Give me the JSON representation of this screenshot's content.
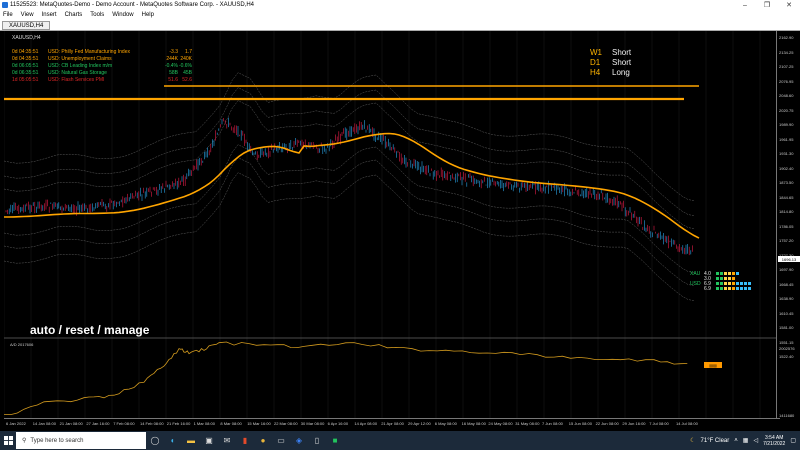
{
  "window": {
    "title": "11525523: MetaQuotes-Demo - Demo Account - MetaQuotes Software Corp. - XAUUSD,H4",
    "min": "–",
    "max": "❐",
    "close": "✕"
  },
  "menu": [
    "File",
    "View",
    "Insert",
    "Charts",
    "Tools",
    "Window",
    "Help"
  ],
  "tab": {
    "label": "XAUUSD,H4"
  },
  "chart": {
    "symbol_label": "XAUUSD,H4",
    "news": [
      {
        "time": "0d 04:35:51",
        "name": "USD: Philly Fed Manufacturing Index",
        "actual": "-3.3",
        "forecast": "1.7",
        "color": "#ffa500"
      },
      {
        "time": "0d 04:35:51",
        "name": "USD: Unemployment Claims",
        "actual": "244K",
        "forecast": "240K",
        "color": "#ffa500"
      },
      {
        "time": "0d 06:05:51",
        "name": "USD: CB Leading Index m/m",
        "actual": "-0.4%",
        "forecast": "-0.6%",
        "color": "#22c55e"
      },
      {
        "time": "0d 06:35:51",
        "name": "USD: Natural Gas Storage",
        "actual": "58B",
        "forecast": "45B",
        "color": "#22c55e"
      },
      {
        "time": "1d 05:05:51",
        "name": "USD: Flash Services PMI",
        "actual": "51.6",
        "forecast": "52.6",
        "color": "#dc2626"
      }
    ],
    "timeframes": [
      {
        "tf": "W1",
        "bias": "Short"
      },
      {
        "tf": "D1",
        "bias": "Short"
      },
      {
        "tf": "H4",
        "bias": "Long"
      }
    ],
    "manage_text": "auto / reset / manage",
    "currency_strength": [
      {
        "currency": "XAU",
        "v1": "4.0",
        "v2": "3.0",
        "color": "#22c55e"
      },
      {
        "currency": "USD",
        "v1": "6.9",
        "v2": "6.9",
        "color": "#22c55e"
      }
    ],
    "indicator_label": "A/D 2017606",
    "price_labels": [
      "2162.90",
      "2134.25",
      "2107.25",
      "2076.95",
      "2048.60",
      "2020.75",
      "1989.90",
      "1961.95",
      "1931.30",
      "1902.40",
      "1873.50",
      "1844.65",
      "1814.80",
      "1786.05",
      "1757.20",
      "1727.30",
      "1697.90",
      "1668.45",
      "1638.90",
      "1610.45",
      "1581.00",
      "1551.15",
      "1522.40"
    ],
    "current_price": "1696.13",
    "osc_labels": [
      "2002576",
      "1411680"
    ],
    "time_labels": [
      "6 Jan 2022",
      "14 Jan 08:00",
      "21 Jan 08:00",
      "27 Jan 16:00",
      "7 Feb 08:00",
      "14 Feb 08:00",
      "21 Feb 16:00",
      "1 Mar 08:00",
      "8 Mar 08:00",
      "15 Mar 16:00",
      "22 Mar 08:00",
      "30 Mar 08:00",
      "6 Apr 16:00",
      "14 Apr 08:00",
      "21 Apr 08:00",
      "29 Apr 12:00",
      "6 May 08:00",
      "16 May 08:00",
      "24 May 08:00",
      "31 May 08:00",
      "7 Jun 08:00",
      "15 Jun 08:00",
      "22 Jun 08:00",
      "29 Jun 16:00",
      "7 Jul 08:00",
      "14 Jul 08:00"
    ]
  },
  "taskbar": {
    "search_placeholder": "Type here to search",
    "icons": [
      "task-view-icon",
      "edge-icon",
      "file-explorer-icon",
      "store-icon",
      "mail-icon",
      "office-icon",
      "chrome-icon",
      "terminal-icon",
      "mt5-icon",
      "phone-icon",
      "green-app-icon"
    ],
    "weather": "71°F  Clear",
    "time": "3:54 AM",
    "date": "7/21/2022"
  },
  "colors": {
    "bull_candle": "#2aa3e6",
    "bear_candle": "#e11d48",
    "ma": "#ffa500",
    "resistance": "#ffa500",
    "envelope": "#9a9a9a",
    "ad_line": "#d29a1e"
  }
}
